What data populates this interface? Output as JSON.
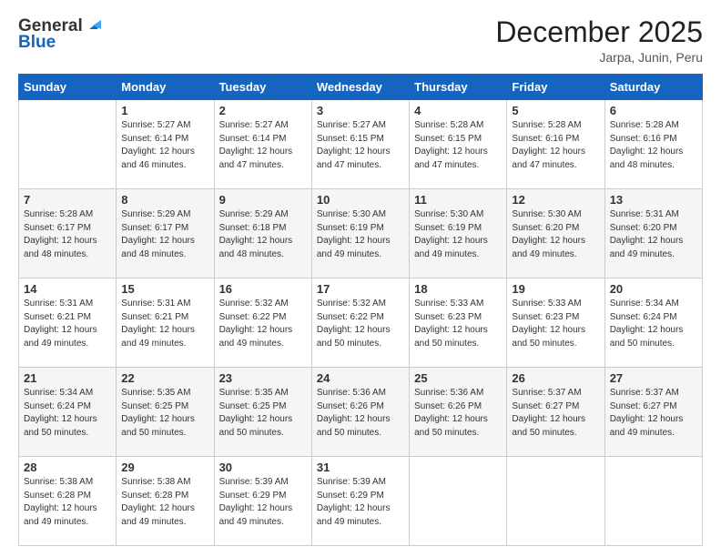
{
  "header": {
    "logo_general": "General",
    "logo_blue": "Blue",
    "title": "December 2025",
    "location": "Jarpa, Junin, Peru"
  },
  "days_of_week": [
    "Sunday",
    "Monday",
    "Tuesday",
    "Wednesday",
    "Thursday",
    "Friday",
    "Saturday"
  ],
  "weeks": [
    [
      {
        "day": "",
        "info": ""
      },
      {
        "day": "1",
        "info": "Sunrise: 5:27 AM\nSunset: 6:14 PM\nDaylight: 12 hours\nand 46 minutes."
      },
      {
        "day": "2",
        "info": "Sunrise: 5:27 AM\nSunset: 6:14 PM\nDaylight: 12 hours\nand 47 minutes."
      },
      {
        "day": "3",
        "info": "Sunrise: 5:27 AM\nSunset: 6:15 PM\nDaylight: 12 hours\nand 47 minutes."
      },
      {
        "day": "4",
        "info": "Sunrise: 5:28 AM\nSunset: 6:15 PM\nDaylight: 12 hours\nand 47 minutes."
      },
      {
        "day": "5",
        "info": "Sunrise: 5:28 AM\nSunset: 6:16 PM\nDaylight: 12 hours\nand 47 minutes."
      },
      {
        "day": "6",
        "info": "Sunrise: 5:28 AM\nSunset: 6:16 PM\nDaylight: 12 hours\nand 48 minutes."
      }
    ],
    [
      {
        "day": "7",
        "info": "Sunrise: 5:28 AM\nSunset: 6:17 PM\nDaylight: 12 hours\nand 48 minutes."
      },
      {
        "day": "8",
        "info": "Sunrise: 5:29 AM\nSunset: 6:17 PM\nDaylight: 12 hours\nand 48 minutes."
      },
      {
        "day": "9",
        "info": "Sunrise: 5:29 AM\nSunset: 6:18 PM\nDaylight: 12 hours\nand 48 minutes."
      },
      {
        "day": "10",
        "info": "Sunrise: 5:30 AM\nSunset: 6:19 PM\nDaylight: 12 hours\nand 49 minutes."
      },
      {
        "day": "11",
        "info": "Sunrise: 5:30 AM\nSunset: 6:19 PM\nDaylight: 12 hours\nand 49 minutes."
      },
      {
        "day": "12",
        "info": "Sunrise: 5:30 AM\nSunset: 6:20 PM\nDaylight: 12 hours\nand 49 minutes."
      },
      {
        "day": "13",
        "info": "Sunrise: 5:31 AM\nSunset: 6:20 PM\nDaylight: 12 hours\nand 49 minutes."
      }
    ],
    [
      {
        "day": "14",
        "info": "Sunrise: 5:31 AM\nSunset: 6:21 PM\nDaylight: 12 hours\nand 49 minutes."
      },
      {
        "day": "15",
        "info": "Sunrise: 5:31 AM\nSunset: 6:21 PM\nDaylight: 12 hours\nand 49 minutes."
      },
      {
        "day": "16",
        "info": "Sunrise: 5:32 AM\nSunset: 6:22 PM\nDaylight: 12 hours\nand 49 minutes."
      },
      {
        "day": "17",
        "info": "Sunrise: 5:32 AM\nSunset: 6:22 PM\nDaylight: 12 hours\nand 50 minutes."
      },
      {
        "day": "18",
        "info": "Sunrise: 5:33 AM\nSunset: 6:23 PM\nDaylight: 12 hours\nand 50 minutes."
      },
      {
        "day": "19",
        "info": "Sunrise: 5:33 AM\nSunset: 6:23 PM\nDaylight: 12 hours\nand 50 minutes."
      },
      {
        "day": "20",
        "info": "Sunrise: 5:34 AM\nSunset: 6:24 PM\nDaylight: 12 hours\nand 50 minutes."
      }
    ],
    [
      {
        "day": "21",
        "info": "Sunrise: 5:34 AM\nSunset: 6:24 PM\nDaylight: 12 hours\nand 50 minutes."
      },
      {
        "day": "22",
        "info": "Sunrise: 5:35 AM\nSunset: 6:25 PM\nDaylight: 12 hours\nand 50 minutes."
      },
      {
        "day": "23",
        "info": "Sunrise: 5:35 AM\nSunset: 6:25 PM\nDaylight: 12 hours\nand 50 minutes."
      },
      {
        "day": "24",
        "info": "Sunrise: 5:36 AM\nSunset: 6:26 PM\nDaylight: 12 hours\nand 50 minutes."
      },
      {
        "day": "25",
        "info": "Sunrise: 5:36 AM\nSunset: 6:26 PM\nDaylight: 12 hours\nand 50 minutes."
      },
      {
        "day": "26",
        "info": "Sunrise: 5:37 AM\nSunset: 6:27 PM\nDaylight: 12 hours\nand 50 minutes."
      },
      {
        "day": "27",
        "info": "Sunrise: 5:37 AM\nSunset: 6:27 PM\nDaylight: 12 hours\nand 49 minutes."
      }
    ],
    [
      {
        "day": "28",
        "info": "Sunrise: 5:38 AM\nSunset: 6:28 PM\nDaylight: 12 hours\nand 49 minutes."
      },
      {
        "day": "29",
        "info": "Sunrise: 5:38 AM\nSunset: 6:28 PM\nDaylight: 12 hours\nand 49 minutes."
      },
      {
        "day": "30",
        "info": "Sunrise: 5:39 AM\nSunset: 6:29 PM\nDaylight: 12 hours\nand 49 minutes."
      },
      {
        "day": "31",
        "info": "Sunrise: 5:39 AM\nSunset: 6:29 PM\nDaylight: 12 hours\nand 49 minutes."
      },
      {
        "day": "",
        "info": ""
      },
      {
        "day": "",
        "info": ""
      },
      {
        "day": "",
        "info": ""
      }
    ]
  ]
}
